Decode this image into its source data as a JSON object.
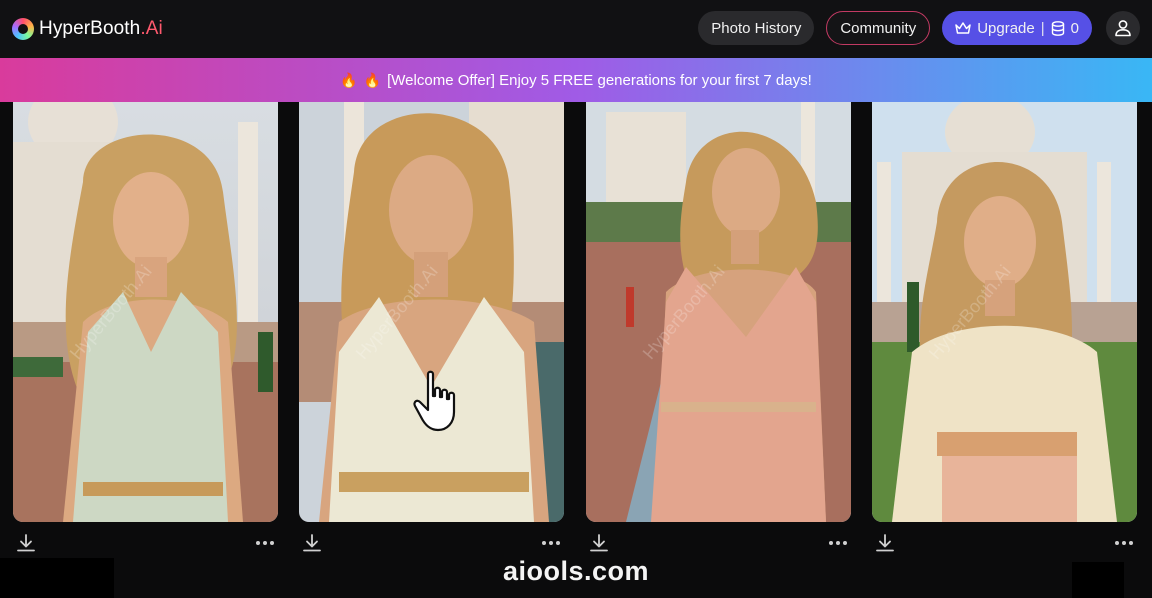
{
  "header": {
    "brand_name": "HyperBooth",
    "brand_suffix": ".Ai",
    "nav": {
      "photo_history": "Photo History",
      "community": "Community",
      "upgrade": "Upgrade",
      "divider": "|",
      "credits": "0"
    }
  },
  "banner": {
    "text": "[Welcome Offer] Enjoy 5 FREE generations for your first 7 days!"
  },
  "gallery": {
    "watermark": "HyperBooth.Ai",
    "cards": [
      {
        "dress_color": "#cdd8c4",
        "trim_color": "#c79a5a"
      },
      {
        "dress_color": "#ece8d4",
        "trim_color": "#c9a060"
      },
      {
        "dress_color": "#e3a58e",
        "trim_color": "#d9b28c"
      },
      {
        "dress_color": "#efe3c6",
        "trim_color": "#d8a070"
      }
    ]
  },
  "site_mark": "aiools.com",
  "icons": {
    "logo": "logo-icon",
    "crown": "crown-icon",
    "credits": "database-icon",
    "user": "user-icon",
    "download": "download-icon",
    "more": "more-icon",
    "flame": "flame-icon",
    "cursor": "hand-cursor-icon"
  },
  "colors": {
    "upgrade_bg": "#5650e6",
    "community_border": "#c23a63",
    "brand_suffix": "#ff5a6e",
    "banner_gradient": [
      "#d93b9c",
      "#a05be6",
      "#39b7f5"
    ]
  }
}
